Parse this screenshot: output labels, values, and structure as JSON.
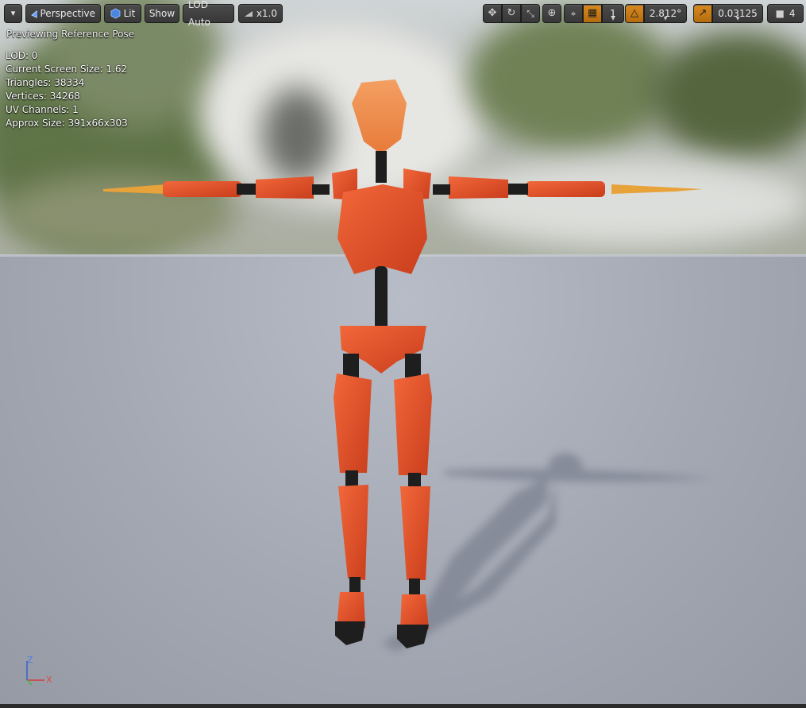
{
  "toolbar": {
    "menu_caret": "▾",
    "perspective_label": "Perspective",
    "lit_label": "Lit",
    "show_label": "Show",
    "lod_label": "LOD Auto",
    "speed_label": "x1.0",
    "grid_snap_value": "1",
    "rotation_snap_value": "2.812°",
    "scale_snap_value": "0.03125",
    "camera_speed_value": "4"
  },
  "overlay": {
    "preview_label": "Previewing Reference Pose",
    "stats": [
      "LOD: 0",
      "Current Screen Size: 1.62",
      "Triangles: 38334",
      "Vertices: 34268",
      "UV Channels: 1",
      "Approx Size: 391x66x303"
    ]
  },
  "axis": {
    "z": "Z",
    "x": "X"
  },
  "colors": {
    "accent": "#d98a1f",
    "mannequin": "#e8532a",
    "floor": "#a7acb7"
  }
}
